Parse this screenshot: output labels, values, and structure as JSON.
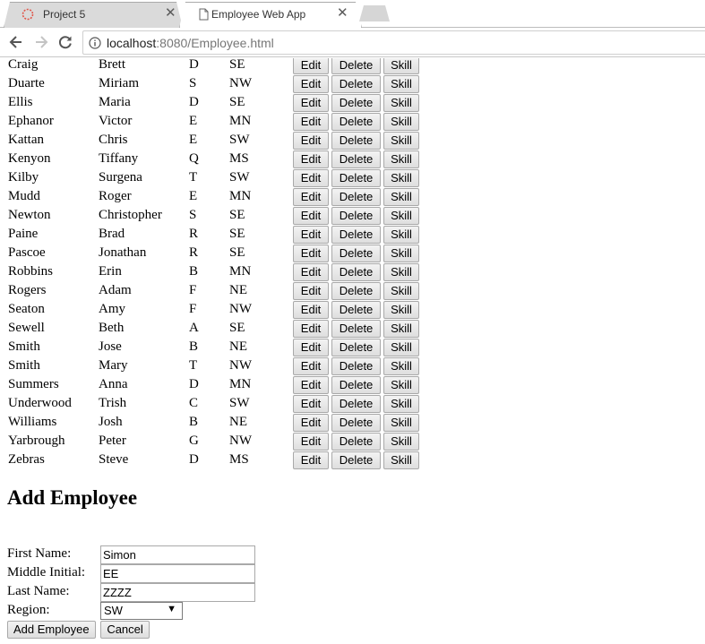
{
  "browser": {
    "tabs": [
      {
        "title": "Project 5",
        "icon": "loading-spinner-icon",
        "active": false
      },
      {
        "title": "Employee Web App",
        "icon": "document-icon",
        "active": true
      }
    ],
    "close_glyph": "✕",
    "url_host": "localhost",
    "url_path": ":8080/Employee.html"
  },
  "employees": [
    {
      "last": "Craig",
      "first": "Brett",
      "mi": "D",
      "region": "SE"
    },
    {
      "last": "Duarte",
      "first": "Miriam",
      "mi": "S",
      "region": "NW"
    },
    {
      "last": "Ellis",
      "first": "Maria",
      "mi": "D",
      "region": "SE"
    },
    {
      "last": "Ephanor",
      "first": "Victor",
      "mi": "E",
      "region": "MN"
    },
    {
      "last": "Kattan",
      "first": "Chris",
      "mi": "E",
      "region": "SW"
    },
    {
      "last": "Kenyon",
      "first": "Tiffany",
      "mi": "Q",
      "region": "MS"
    },
    {
      "last": "Kilby",
      "first": "Surgena",
      "mi": "T",
      "region": "SW"
    },
    {
      "last": "Mudd",
      "first": "Roger",
      "mi": "E",
      "region": "MN"
    },
    {
      "last": "Newton",
      "first": "Christopher",
      "mi": "S",
      "region": "SE"
    },
    {
      "last": "Paine",
      "first": "Brad",
      "mi": "R",
      "region": "SE"
    },
    {
      "last": "Pascoe",
      "first": "Jonathan",
      "mi": "R",
      "region": "SE"
    },
    {
      "last": "Robbins",
      "first": "Erin",
      "mi": "B",
      "region": "MN"
    },
    {
      "last": "Rogers",
      "first": "Adam",
      "mi": "F",
      "region": "NE"
    },
    {
      "last": "Seaton",
      "first": "Amy",
      "mi": "F",
      "region": "NW"
    },
    {
      "last": "Sewell",
      "first": "Beth",
      "mi": "A",
      "region": "SE"
    },
    {
      "last": "Smith",
      "first": "Jose",
      "mi": "B",
      "region": "NE"
    },
    {
      "last": "Smith",
      "first": "Mary",
      "mi": "T",
      "region": "NW"
    },
    {
      "last": "Summers",
      "first": "Anna",
      "mi": "D",
      "region": "MN"
    },
    {
      "last": "Underwood",
      "first": "Trish",
      "mi": "C",
      "region": "SW"
    },
    {
      "last": "Williams",
      "first": "Josh",
      "mi": "B",
      "region": "NE"
    },
    {
      "last": "Yarbrough",
      "first": "Peter",
      "mi": "G",
      "region": "NW"
    },
    {
      "last": "Zebras",
      "first": "Steve",
      "mi": "D",
      "region": "MS"
    }
  ],
  "row_actions": {
    "edit": "Edit",
    "delete": "Delete",
    "skill": "Skill"
  },
  "add_form": {
    "title": "Add Employee",
    "first_name_label": "First Name:",
    "first_name_value": "Simon",
    "middle_initial_label": "Middle Initial:",
    "middle_initial_value": "EE",
    "last_name_label": "Last Name:",
    "last_name_value": "ZZZZ",
    "region_label": "Region:",
    "region_value": "SW",
    "submit_label": "Add Employee",
    "cancel_label": "Cancel"
  }
}
